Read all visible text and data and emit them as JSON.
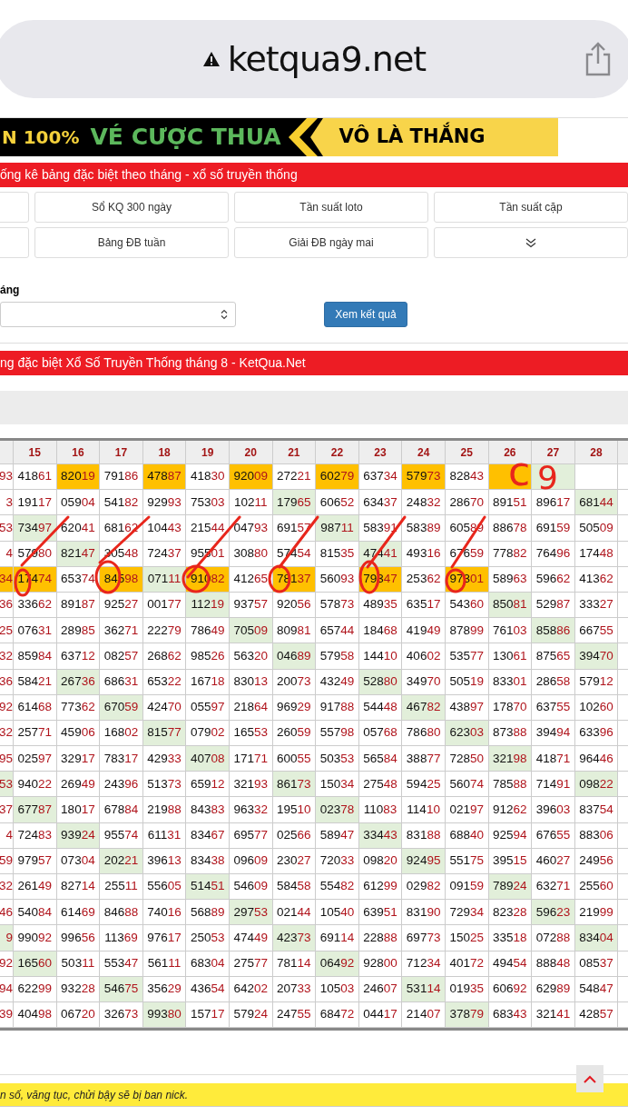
{
  "browser": {
    "url": "ketqua9.net"
  },
  "banner": {
    "left": "N 100%",
    "middle": "VÉ CƯỢC THUA",
    "right": "VÔ LÀ THẮNG"
  },
  "section_title": "ống kê bảng đặc biệt theo tháng - xổ số truyền thống",
  "nav_rows": [
    [
      "Sổ KQ 300 ngày",
      "Tần suất loto",
      "Tần suất cặp"
    ],
    [
      "Bảng ĐB tuần",
      "Giải ĐB ngày mai"
    ]
  ],
  "form": {
    "label": "áng",
    "submit": "Xem kết quả"
  },
  "table_title": "ng đặc biệt Xổ Số Truyền Thống tháng 8 - KetQua.Net",
  "table": {
    "columns": [
      "15",
      "16",
      "17",
      "18",
      "19",
      "20",
      "21",
      "22",
      "23",
      "24",
      "25",
      "26",
      "27",
      "28"
    ],
    "rows": [
      {
        "edge": {
          "t": "93",
          "kind": "plain"
        },
        "cells": [
          {
            "t": "41861",
            "kind": "plain"
          },
          {
            "t": "82019",
            "kind": "orange"
          },
          {
            "t": "79186",
            "kind": "plain"
          },
          {
            "t": "47887",
            "kind": "orange"
          },
          {
            "t": "41830",
            "kind": "plain"
          },
          {
            "t": "92009",
            "kind": "orange"
          },
          {
            "t": "27221",
            "kind": "plain"
          },
          {
            "t": "60279",
            "kind": "orange"
          },
          {
            "t": "63734",
            "kind": "plain"
          },
          {
            "t": "57973",
            "kind": "orange"
          },
          {
            "t": "82843",
            "kind": "plain"
          },
          {
            "kind": "orange"
          },
          {
            "kind": "green"
          },
          {
            "kind": "plain"
          }
        ]
      },
      {
        "edge": {
          "t": "3",
          "kind": "plain"
        },
        "cells": [
          {
            "t": "19117",
            "kind": "plain"
          },
          {
            "t": "05904",
            "kind": "plain"
          },
          {
            "t": "54182",
            "kind": "plain"
          },
          {
            "t": "92993",
            "kind": "plain"
          },
          {
            "t": "75303",
            "kind": "plain"
          },
          {
            "t": "10211",
            "kind": "plain"
          },
          {
            "t": "17965",
            "kind": "green"
          },
          {
            "t": "60652",
            "kind": "plain"
          },
          {
            "t": "63437",
            "kind": "plain"
          },
          {
            "t": "24832",
            "kind": "plain"
          },
          {
            "t": "28670",
            "kind": "plain"
          },
          {
            "t": "89151",
            "kind": "plain"
          },
          {
            "t": "89617",
            "kind": "plain"
          },
          {
            "t": "68144",
            "kind": "green"
          }
        ]
      },
      {
        "edge": {
          "t": "53",
          "kind": "plain"
        },
        "cells": [
          {
            "t": "73497",
            "kind": "green"
          },
          {
            "t": "62041",
            "kind": "plain"
          },
          {
            "t": "68162",
            "kind": "plain"
          },
          {
            "t": "10443",
            "kind": "plain"
          },
          {
            "t": "21544",
            "kind": "plain"
          },
          {
            "t": "04793",
            "kind": "plain"
          },
          {
            "t": "69157",
            "kind": "plain"
          },
          {
            "t": "98711",
            "kind": "green"
          },
          {
            "t": "58391",
            "kind": "plain"
          },
          {
            "t": "58389",
            "kind": "plain"
          },
          {
            "t": "60589",
            "kind": "plain"
          },
          {
            "t": "88678",
            "kind": "plain"
          },
          {
            "t": "69159",
            "kind": "plain"
          },
          {
            "t": "50509",
            "kind": "plain"
          }
        ]
      },
      {
        "edge": {
          "t": "4",
          "kind": "plain"
        },
        "cells": [
          {
            "t": "57980",
            "kind": "plain"
          },
          {
            "t": "82147",
            "kind": "green"
          },
          {
            "t": "30548",
            "kind": "plain"
          },
          {
            "t": "72437",
            "kind": "plain"
          },
          {
            "t": "95501",
            "kind": "plain"
          },
          {
            "t": "30880",
            "kind": "plain"
          },
          {
            "t": "57454",
            "kind": "plain"
          },
          {
            "t": "81535",
            "kind": "plain"
          },
          {
            "t": "47441",
            "kind": "green"
          },
          {
            "t": "49316",
            "kind": "plain"
          },
          {
            "t": "67659",
            "kind": "plain"
          },
          {
            "t": "77882",
            "kind": "plain"
          },
          {
            "t": "76496",
            "kind": "plain"
          },
          {
            "t": "17448",
            "kind": "plain"
          }
        ]
      },
      {
        "edge": {
          "t": "34",
          "kind": "orange"
        },
        "cells": [
          {
            "t": "17474",
            "kind": "orange"
          },
          {
            "t": "65374",
            "kind": "plain"
          },
          {
            "t": "84598",
            "kind": "orange"
          },
          {
            "t": "07111",
            "kind": "green"
          },
          {
            "t": "91082",
            "kind": "orange"
          },
          {
            "t": "41265",
            "kind": "plain"
          },
          {
            "t": "78137",
            "kind": "orange"
          },
          {
            "t": "56093",
            "kind": "plain"
          },
          {
            "t": "79347",
            "kind": "orange"
          },
          {
            "t": "25362",
            "kind": "plain"
          },
          {
            "t": "97301",
            "kind": "orange"
          },
          {
            "t": "58963",
            "kind": "plain"
          },
          {
            "t": "59662",
            "kind": "plain"
          },
          {
            "t": "41362",
            "kind": "plain"
          }
        ]
      },
      {
        "edge": {
          "t": "36",
          "kind": "plain"
        },
        "cells": [
          {
            "t": "33662",
            "kind": "plain"
          },
          {
            "t": "89187",
            "kind": "plain"
          },
          {
            "t": "92527",
            "kind": "plain"
          },
          {
            "t": "00177",
            "kind": "plain"
          },
          {
            "t": "11219",
            "kind": "green"
          },
          {
            "t": "93757",
            "kind": "plain"
          },
          {
            "t": "92056",
            "kind": "plain"
          },
          {
            "t": "57873",
            "kind": "plain"
          },
          {
            "t": "48935",
            "kind": "plain"
          },
          {
            "t": "63517",
            "kind": "plain"
          },
          {
            "t": "54360",
            "kind": "plain"
          },
          {
            "t": "85081",
            "kind": "green"
          },
          {
            "t": "52987",
            "kind": "plain"
          },
          {
            "t": "33327",
            "kind": "plain"
          }
        ]
      },
      {
        "edge": {
          "t": "25",
          "kind": "plain"
        },
        "cells": [
          {
            "t": "07631",
            "kind": "plain"
          },
          {
            "t": "28985",
            "kind": "plain"
          },
          {
            "t": "36271",
            "kind": "plain"
          },
          {
            "t": "22279",
            "kind": "plain"
          },
          {
            "t": "78649",
            "kind": "plain"
          },
          {
            "t": "70509",
            "kind": "green"
          },
          {
            "t": "80981",
            "kind": "plain"
          },
          {
            "t": "65744",
            "kind": "plain"
          },
          {
            "t": "18468",
            "kind": "plain"
          },
          {
            "t": "41949",
            "kind": "plain"
          },
          {
            "t": "87899",
            "kind": "plain"
          },
          {
            "t": "76103",
            "kind": "plain"
          },
          {
            "t": "85886",
            "kind": "green"
          },
          {
            "t": "66755",
            "kind": "plain"
          }
        ]
      },
      {
        "edge": {
          "t": "32",
          "kind": "plain"
        },
        "cells": [
          {
            "t": "85984",
            "kind": "plain"
          },
          {
            "t": "63712",
            "kind": "plain"
          },
          {
            "t": "08257",
            "kind": "plain"
          },
          {
            "t": "26862",
            "kind": "plain"
          },
          {
            "t": "98526",
            "kind": "plain"
          },
          {
            "t": "56320",
            "kind": "plain"
          },
          {
            "t": "04689",
            "kind": "green"
          },
          {
            "t": "57958",
            "kind": "plain"
          },
          {
            "t": "14410",
            "kind": "plain"
          },
          {
            "t": "40602",
            "kind": "plain"
          },
          {
            "t": "53577",
            "kind": "plain"
          },
          {
            "t": "13061",
            "kind": "plain"
          },
          {
            "t": "87565",
            "kind": "plain"
          },
          {
            "t": "39470",
            "kind": "green"
          }
        ]
      },
      {
        "edge": {
          "t": "36",
          "kind": "plain"
        },
        "cells": [
          {
            "t": "58421",
            "kind": "plain"
          },
          {
            "t": "26736",
            "kind": "green"
          },
          {
            "t": "68631",
            "kind": "plain"
          },
          {
            "t": "65322",
            "kind": "plain"
          },
          {
            "t": "16718",
            "kind": "plain"
          },
          {
            "t": "83013",
            "kind": "plain"
          },
          {
            "t": "20073",
            "kind": "plain"
          },
          {
            "t": "43249",
            "kind": "plain"
          },
          {
            "t": "52880",
            "kind": "green"
          },
          {
            "t": "34970",
            "kind": "plain"
          },
          {
            "t": "50519",
            "kind": "plain"
          },
          {
            "t": "83301",
            "kind": "plain"
          },
          {
            "t": "28658",
            "kind": "plain"
          },
          {
            "t": "57912",
            "kind": "plain"
          }
        ]
      },
      {
        "edge": {
          "t": "92",
          "kind": "plain"
        },
        "cells": [
          {
            "t": "61468",
            "kind": "plain"
          },
          {
            "t": "77362",
            "kind": "plain"
          },
          {
            "t": "67059",
            "kind": "green"
          },
          {
            "t": "42470",
            "kind": "plain"
          },
          {
            "t": "05597",
            "kind": "plain"
          },
          {
            "t": "21864",
            "kind": "plain"
          },
          {
            "t": "96929",
            "kind": "plain"
          },
          {
            "t": "91788",
            "kind": "plain"
          },
          {
            "t": "54448",
            "kind": "plain"
          },
          {
            "t": "46782",
            "kind": "green"
          },
          {
            "t": "43897",
            "kind": "plain"
          },
          {
            "t": "17870",
            "kind": "plain"
          },
          {
            "t": "63755",
            "kind": "plain"
          },
          {
            "t": "10260",
            "kind": "plain"
          }
        ]
      },
      {
        "edge": {
          "t": "32",
          "kind": "plain"
        },
        "cells": [
          {
            "t": "25771",
            "kind": "plain"
          },
          {
            "t": "45906",
            "kind": "plain"
          },
          {
            "t": "16802",
            "kind": "plain"
          },
          {
            "t": "81577",
            "kind": "green"
          },
          {
            "t": "07902",
            "kind": "plain"
          },
          {
            "t": "16553",
            "kind": "plain"
          },
          {
            "t": "26059",
            "kind": "plain"
          },
          {
            "t": "55798",
            "kind": "plain"
          },
          {
            "t": "05768",
            "kind": "plain"
          },
          {
            "t": "78680",
            "kind": "plain"
          },
          {
            "t": "62303",
            "kind": "green"
          },
          {
            "t": "87388",
            "kind": "plain"
          },
          {
            "t": "39494",
            "kind": "plain"
          },
          {
            "t": "63396",
            "kind": "plain"
          }
        ]
      },
      {
        "edge": {
          "t": "95",
          "kind": "plain"
        },
        "cells": [
          {
            "t": "02597",
            "kind": "plain"
          },
          {
            "t": "32917",
            "kind": "plain"
          },
          {
            "t": "78317",
            "kind": "plain"
          },
          {
            "t": "42933",
            "kind": "plain"
          },
          {
            "t": "40708",
            "kind": "green"
          },
          {
            "t": "17171",
            "kind": "plain"
          },
          {
            "t": "60055",
            "kind": "plain"
          },
          {
            "t": "50353",
            "kind": "plain"
          },
          {
            "t": "56584",
            "kind": "plain"
          },
          {
            "t": "38877",
            "kind": "plain"
          },
          {
            "t": "72850",
            "kind": "plain"
          },
          {
            "t": "32198",
            "kind": "green"
          },
          {
            "t": "41871",
            "kind": "plain"
          },
          {
            "t": "96446",
            "kind": "plain"
          }
        ]
      },
      {
        "edge": {
          "t": "53",
          "kind": "green"
        },
        "cells": [
          {
            "t": "94022",
            "kind": "plain"
          },
          {
            "t": "26949",
            "kind": "plain"
          },
          {
            "t": "24396",
            "kind": "plain"
          },
          {
            "t": "51373",
            "kind": "plain"
          },
          {
            "t": "65912",
            "kind": "plain"
          },
          {
            "t": "32193",
            "kind": "plain"
          },
          {
            "t": "86173",
            "kind": "green"
          },
          {
            "t": "15034",
            "kind": "plain"
          },
          {
            "t": "27548",
            "kind": "plain"
          },
          {
            "t": "59425",
            "kind": "plain"
          },
          {
            "t": "56074",
            "kind": "plain"
          },
          {
            "t": "78588",
            "kind": "plain"
          },
          {
            "t": "71491",
            "kind": "plain"
          },
          {
            "t": "09822",
            "kind": "green"
          }
        ]
      },
      {
        "edge": {
          "t": "37",
          "kind": "plain"
        },
        "cells": [
          {
            "t": "67787",
            "kind": "green"
          },
          {
            "t": "18017",
            "kind": "plain"
          },
          {
            "t": "67884",
            "kind": "plain"
          },
          {
            "t": "21988",
            "kind": "plain"
          },
          {
            "t": "84383",
            "kind": "plain"
          },
          {
            "t": "96332",
            "kind": "plain"
          },
          {
            "t": "19510",
            "kind": "plain"
          },
          {
            "t": "02378",
            "kind": "green"
          },
          {
            "t": "11083",
            "kind": "plain"
          },
          {
            "t": "11410",
            "kind": "plain"
          },
          {
            "t": "02197",
            "kind": "plain"
          },
          {
            "t": "91262",
            "kind": "plain"
          },
          {
            "t": "39603",
            "kind": "plain"
          },
          {
            "t": "83754",
            "kind": "plain"
          }
        ]
      },
      {
        "edge": {
          "t": "4",
          "kind": "plain"
        },
        "cells": [
          {
            "t": "72483",
            "kind": "plain"
          },
          {
            "t": "93924",
            "kind": "green"
          },
          {
            "t": "95574",
            "kind": "plain"
          },
          {
            "t": "61131",
            "kind": "plain"
          },
          {
            "t": "83467",
            "kind": "plain"
          },
          {
            "t": "69577",
            "kind": "plain"
          },
          {
            "t": "02566",
            "kind": "plain"
          },
          {
            "t": "58947",
            "kind": "plain"
          },
          {
            "t": "33443",
            "kind": "green"
          },
          {
            "t": "83188",
            "kind": "plain"
          },
          {
            "t": "68840",
            "kind": "plain"
          },
          {
            "t": "92594",
            "kind": "plain"
          },
          {
            "t": "67655",
            "kind": "plain"
          },
          {
            "t": "88306",
            "kind": "plain"
          }
        ]
      },
      {
        "edge": {
          "t": "59",
          "kind": "plain"
        },
        "cells": [
          {
            "t": "97957",
            "kind": "plain"
          },
          {
            "t": "07304",
            "kind": "plain"
          },
          {
            "t": "20221",
            "kind": "green"
          },
          {
            "t": "39613",
            "kind": "plain"
          },
          {
            "t": "83438",
            "kind": "plain"
          },
          {
            "t": "09609",
            "kind": "plain"
          },
          {
            "t": "23027",
            "kind": "plain"
          },
          {
            "t": "72033",
            "kind": "plain"
          },
          {
            "t": "09820",
            "kind": "plain"
          },
          {
            "t": "92495",
            "kind": "green"
          },
          {
            "t": "55175",
            "kind": "plain"
          },
          {
            "t": "39515",
            "kind": "plain"
          },
          {
            "t": "46027",
            "kind": "plain"
          },
          {
            "t": "24956",
            "kind": "plain"
          }
        ]
      },
      {
        "edge": {
          "t": "32",
          "kind": "plain"
        },
        "cells": [
          {
            "t": "26149",
            "kind": "plain"
          },
          {
            "t": "82714",
            "kind": "plain"
          },
          {
            "t": "25511",
            "kind": "plain"
          },
          {
            "t": "55605",
            "kind": "plain"
          },
          {
            "t": "51451",
            "kind": "green"
          },
          {
            "t": "54609",
            "kind": "plain"
          },
          {
            "t": "58458",
            "kind": "plain"
          },
          {
            "t": "55482",
            "kind": "plain"
          },
          {
            "t": "61299",
            "kind": "plain"
          },
          {
            "t": "02982",
            "kind": "plain"
          },
          {
            "t": "09159",
            "kind": "plain"
          },
          {
            "t": "78924",
            "kind": "green"
          },
          {
            "t": "63271",
            "kind": "plain"
          },
          {
            "t": "25560",
            "kind": "plain"
          }
        ]
      },
      {
        "edge": {
          "t": "46",
          "kind": "plain"
        },
        "cells": [
          {
            "t": "54084",
            "kind": "plain"
          },
          {
            "t": "61469",
            "kind": "plain"
          },
          {
            "t": "84688",
            "kind": "plain"
          },
          {
            "t": "74016",
            "kind": "plain"
          },
          {
            "t": "56889",
            "kind": "plain"
          },
          {
            "t": "29753",
            "kind": "green"
          },
          {
            "t": "02144",
            "kind": "plain"
          },
          {
            "t": "10540",
            "kind": "plain"
          },
          {
            "t": "63951",
            "kind": "plain"
          },
          {
            "t": "83190",
            "kind": "plain"
          },
          {
            "t": "72934",
            "kind": "plain"
          },
          {
            "t": "82328",
            "kind": "plain"
          },
          {
            "t": "59623",
            "kind": "green"
          },
          {
            "t": "21999",
            "kind": "plain"
          }
        ]
      },
      {
        "edge": {
          "t": "9",
          "kind": "green"
        },
        "cells": [
          {
            "t": "99092",
            "kind": "plain"
          },
          {
            "t": "99656",
            "kind": "plain"
          },
          {
            "t": "11369",
            "kind": "plain"
          },
          {
            "t": "97617",
            "kind": "plain"
          },
          {
            "t": "25053",
            "kind": "plain"
          },
          {
            "t": "47449",
            "kind": "plain"
          },
          {
            "t": "42373",
            "kind": "green"
          },
          {
            "t": "69114",
            "kind": "plain"
          },
          {
            "t": "22888",
            "kind": "plain"
          },
          {
            "t": "69773",
            "kind": "plain"
          },
          {
            "t": "15025",
            "kind": "plain"
          },
          {
            "t": "33518",
            "kind": "plain"
          },
          {
            "t": "07288",
            "kind": "plain"
          },
          {
            "t": "83404",
            "kind": "green"
          }
        ]
      },
      {
        "edge": {
          "t": "92",
          "kind": "plain"
        },
        "cells": [
          {
            "t": "16560",
            "kind": "green"
          },
          {
            "t": "50311",
            "kind": "plain"
          },
          {
            "t": "55347",
            "kind": "plain"
          },
          {
            "t": "56111",
            "kind": "plain"
          },
          {
            "t": "68304",
            "kind": "plain"
          },
          {
            "t": "27577",
            "kind": "plain"
          },
          {
            "t": "78114",
            "kind": "plain"
          },
          {
            "t": "06492",
            "kind": "green"
          },
          {
            "t": "92800",
            "kind": "plain"
          },
          {
            "t": "71234",
            "kind": "plain"
          },
          {
            "t": "40172",
            "kind": "plain"
          },
          {
            "t": "49454",
            "kind": "plain"
          },
          {
            "t": "88848",
            "kind": "plain"
          },
          {
            "t": "08537",
            "kind": "plain"
          }
        ]
      },
      {
        "edge": {
          "t": "94",
          "kind": "plain"
        },
        "cells": [
          {
            "t": "62299",
            "kind": "plain"
          },
          {
            "t": "93228",
            "kind": "plain"
          },
          {
            "t": "54675",
            "kind": "green"
          },
          {
            "t": "35629",
            "kind": "plain"
          },
          {
            "t": "43654",
            "kind": "plain"
          },
          {
            "t": "64202",
            "kind": "plain"
          },
          {
            "t": "20733",
            "kind": "plain"
          },
          {
            "t": "10503",
            "kind": "plain"
          },
          {
            "t": "24607",
            "kind": "plain"
          },
          {
            "t": "53114",
            "kind": "green"
          },
          {
            "t": "01935",
            "kind": "plain"
          },
          {
            "t": "60692",
            "kind": "plain"
          },
          {
            "t": "62989",
            "kind": "plain"
          },
          {
            "t": "54847",
            "kind": "plain"
          }
        ]
      },
      {
        "edge": {
          "t": "39",
          "kind": "plain"
        },
        "cells": [
          {
            "t": "40498",
            "kind": "plain"
          },
          {
            "t": "06720",
            "kind": "plain"
          },
          {
            "t": "32673",
            "kind": "plain"
          },
          {
            "t": "99380",
            "kind": "green"
          },
          {
            "t": "15717",
            "kind": "plain"
          },
          {
            "t": "57924",
            "kind": "plain"
          },
          {
            "t": "24755",
            "kind": "plain"
          },
          {
            "t": "68472",
            "kind": "plain"
          },
          {
            "t": "04417",
            "kind": "plain"
          },
          {
            "t": "21407",
            "kind": "plain"
          },
          {
            "t": "37879",
            "kind": "green"
          },
          {
            "t": "68343",
            "kind": "plain"
          },
          {
            "t": "32141",
            "kind": "plain"
          },
          {
            "t": "42857",
            "kind": "plain"
          }
        ]
      }
    ]
  },
  "handwriting": [
    "c",
    "9"
  ],
  "notice": "n số, văng tục, chửi bậy sẽ bị ban nick."
}
